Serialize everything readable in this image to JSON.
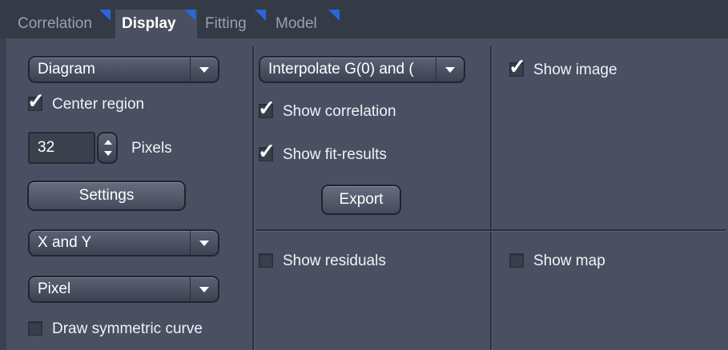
{
  "tabs": [
    {
      "label": "Correlation",
      "active": false
    },
    {
      "label": "Display",
      "active": true
    },
    {
      "label": "Fitting",
      "active": false
    },
    {
      "label": "Model",
      "active": false
    }
  ],
  "left": {
    "view_dropdown": "Diagram",
    "center_region": {
      "label": "Center region",
      "checked": true
    },
    "pixels_value": "32",
    "pixels_unit": "Pixels",
    "settings_button": "Settings",
    "axis_dropdown": "X and Y",
    "unit_dropdown": "Pixel",
    "draw_symmetric": {
      "label": "Draw symmetric curve",
      "checked": false
    }
  },
  "middle": {
    "interpolate_dropdown": "Interpolate G(0) and (",
    "show_correlation": {
      "label": "Show correlation",
      "checked": true
    },
    "show_fit_results": {
      "label": "Show fit-results",
      "checked": true
    },
    "export_button": "Export",
    "show_residuals": {
      "label": "Show residuals",
      "checked": false
    }
  },
  "right": {
    "show_image": {
      "label": "Show image",
      "checked": true
    },
    "show_map": {
      "label": "Show map",
      "checked": false
    }
  },
  "check_glyph": "✓"
}
